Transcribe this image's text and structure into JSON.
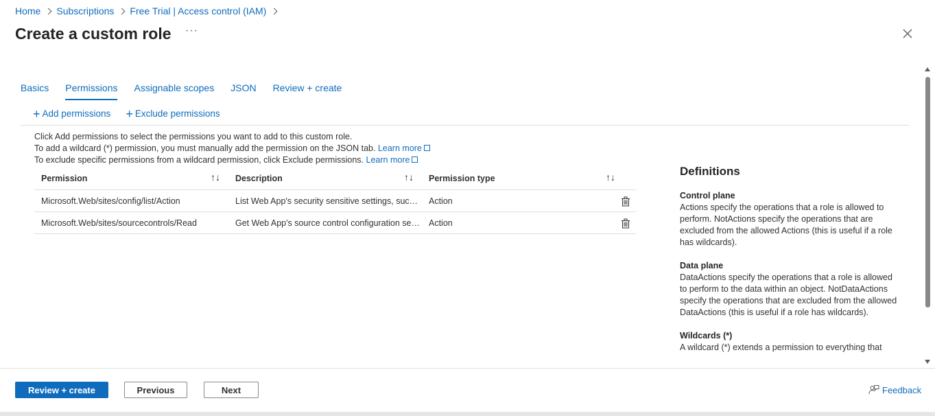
{
  "breadcrumb": {
    "items": [
      "Home",
      "Subscriptions",
      "Free Trial | Access control (IAM)"
    ]
  },
  "page": {
    "title": "Create a custom role",
    "more_label": "···"
  },
  "tabs": [
    {
      "label": "Basics",
      "active": false
    },
    {
      "label": "Permissions",
      "active": true
    },
    {
      "label": "Assignable scopes",
      "active": false
    },
    {
      "label": "JSON",
      "active": false
    },
    {
      "label": "Review + create",
      "active": false
    }
  ],
  "toolbar": {
    "add_label": "Add permissions",
    "exclude_label": "Exclude permissions"
  },
  "info": {
    "line1": "Click Add permissions to select the permissions you want to add to this custom role.",
    "line2": "To add a wildcard (*) permission, you must manually add the permission on the JSON tab.",
    "line3": "To exclude specific permissions from a wildcard permission, click Exclude permissions.",
    "learn_more": "Learn more"
  },
  "grid": {
    "headers": [
      "Permission",
      "Description",
      "Permission type"
    ],
    "sort_icon": "↑↓",
    "rows": [
      {
        "permission": "Microsoft.Web/sites/config/list/Action",
        "description": "List Web App's security sensitive settings, such as publishing credentials, app settings and connection strings",
        "type": "Action"
      },
      {
        "permission": "Microsoft.Web/sites/sourcecontrols/Read",
        "description": "Get Web App's source control configuration settings.",
        "type": "Action"
      }
    ]
  },
  "definitions": {
    "title": "Definitions",
    "sections": [
      {
        "heading": "Control plane",
        "body": "Actions specify the operations that a role is allowed to perform. NotActions specify the operations that are excluded from the allowed Actions (this is useful if a role has wildcards)."
      },
      {
        "heading": "Data plane",
        "body": "DataActions specify the operations that a role is allowed to perform to the data within an object. NotDataActions specify the operations that are excluded from the allowed DataActions (this is useful if a role has wildcards)."
      },
      {
        "heading": "Wildcards (*)",
        "body": "A wildcard (*) extends a permission to everything that"
      }
    ]
  },
  "footer": {
    "review_create": "Review + create",
    "previous": "Previous",
    "next": "Next",
    "feedback": "Feedback"
  },
  "colors": {
    "accent": "#0f6cbd",
    "text": "#323130",
    "border": "#e1dfdd"
  }
}
